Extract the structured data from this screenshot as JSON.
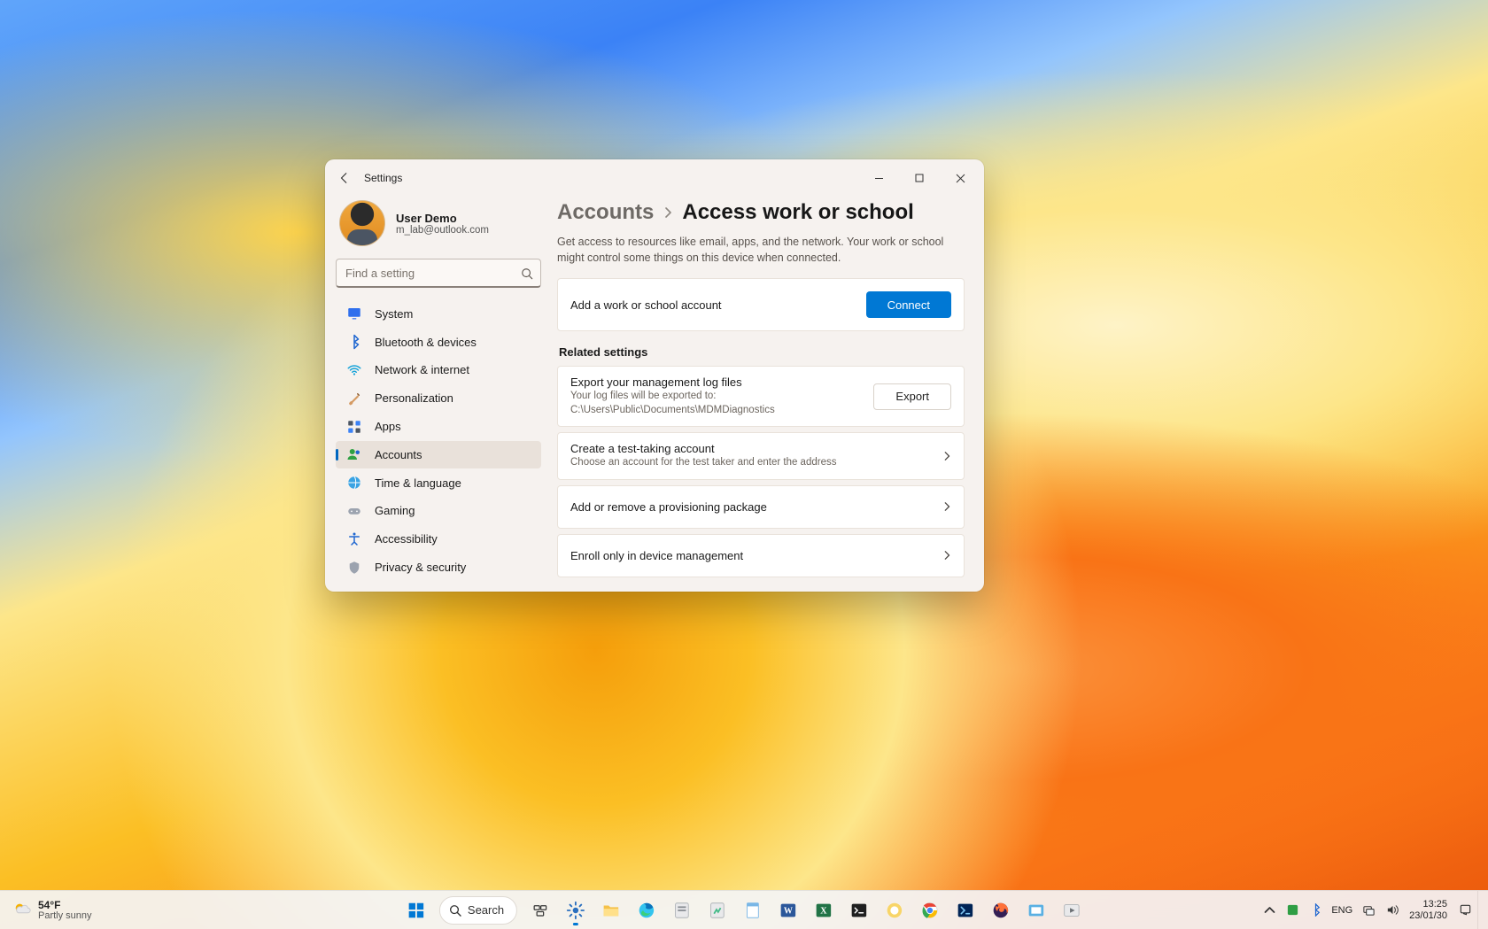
{
  "window": {
    "title": "Settings",
    "user_name": "User Demo",
    "user_email": "m_lab@outlook.com",
    "search_placeholder": "Find a setting"
  },
  "sidebar": {
    "items": [
      {
        "id": "system",
        "label": "System"
      },
      {
        "id": "bluetooth",
        "label": "Bluetooth & devices"
      },
      {
        "id": "network",
        "label": "Network & internet"
      },
      {
        "id": "personalization",
        "label": "Personalization"
      },
      {
        "id": "apps",
        "label": "Apps"
      },
      {
        "id": "accounts",
        "label": "Accounts"
      },
      {
        "id": "time",
        "label": "Time & language"
      },
      {
        "id": "gaming",
        "label": "Gaming"
      },
      {
        "id": "accessibility",
        "label": "Accessibility"
      },
      {
        "id": "privacy",
        "label": "Privacy & security"
      }
    ],
    "active_index": 5
  },
  "main": {
    "breadcrumb_parent": "Accounts",
    "breadcrumb_current": "Access work or school",
    "description": "Get access to resources like email, apps, and the network. Your work or school might control some things on this device when connected.",
    "connect_card": {
      "title": "Add a work or school account",
      "button": "Connect"
    },
    "related_header": "Related settings",
    "export_card": {
      "title": "Export your management log files",
      "sub": "Your log files will be exported to: C:\\Users\\Public\\Documents\\MDMDiagnostics",
      "button": "Export"
    },
    "test_card": {
      "title": "Create a test-taking account",
      "sub": "Choose an account for the test taker and enter the address"
    },
    "provision_card": {
      "title": "Add or remove a provisioning package"
    },
    "enroll_card": {
      "title": "Enroll only in device management"
    }
  },
  "taskbar": {
    "weather_temp": "54°F",
    "weather_cond": "Partly sunny",
    "search_label": "Search",
    "lang": "ENG",
    "clock_time": "13:25",
    "clock_date": "23/01/30",
    "apps": [
      "start",
      "search",
      "task-view",
      "settings",
      "file-explorer",
      "edge",
      "generic-app-1",
      "generic-app-2",
      "notepad",
      "word",
      "excel",
      "terminal",
      "onenote",
      "chrome",
      "powershell",
      "firefox",
      "snipping-tool",
      "media-app"
    ]
  }
}
